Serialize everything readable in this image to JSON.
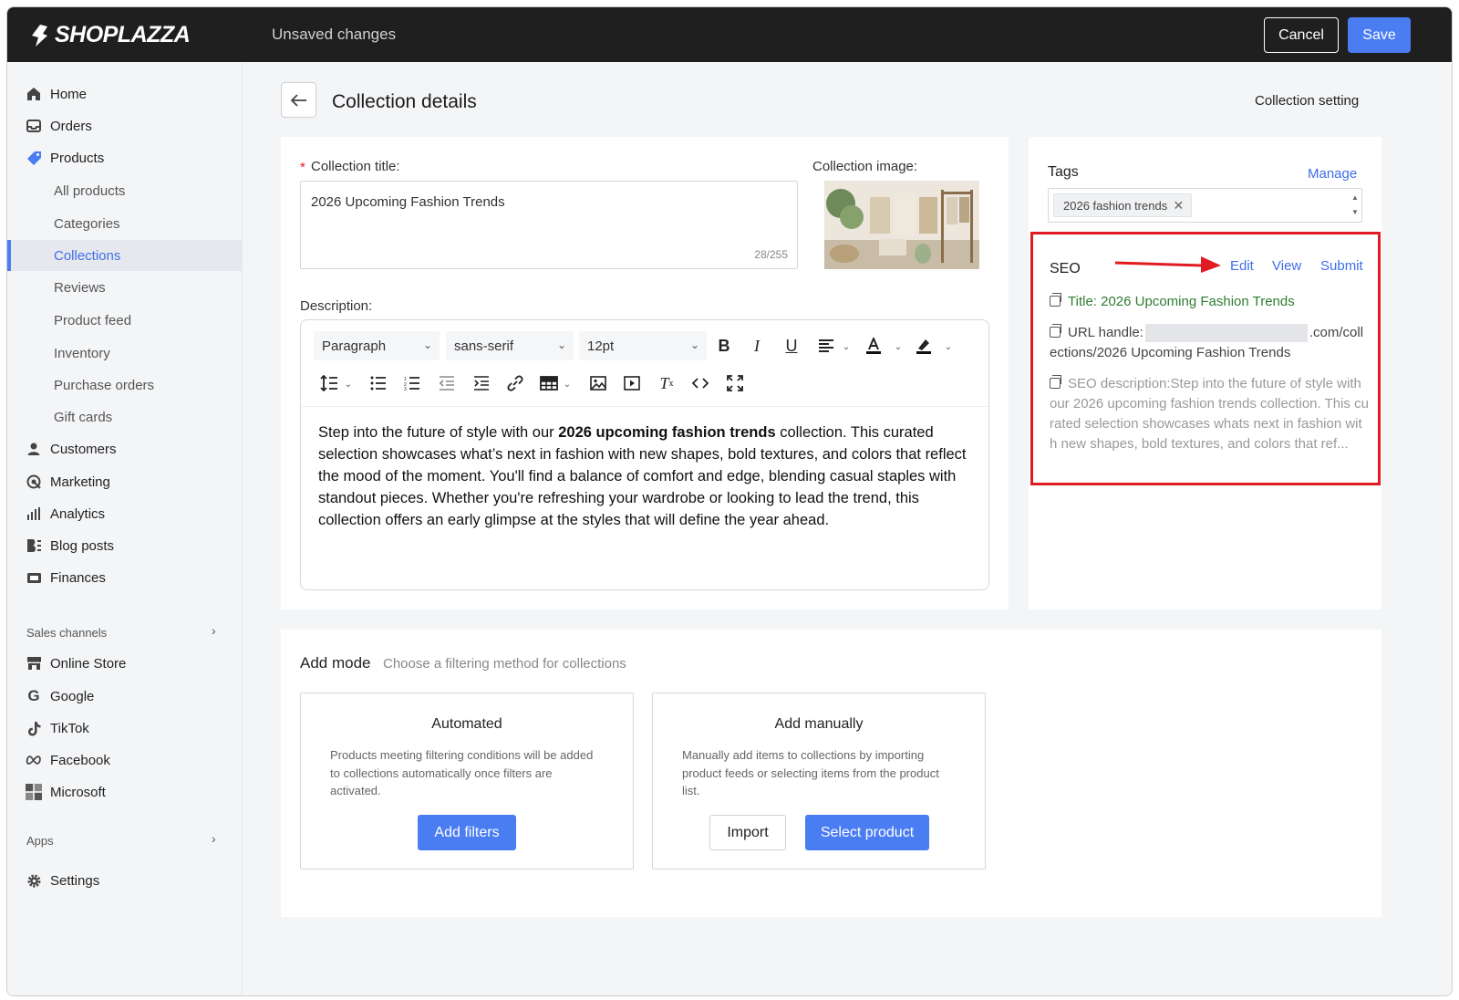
{
  "topbar": {
    "brand": "SHOPLAZZA",
    "status": "Unsaved changes",
    "cancel_label": "Cancel",
    "save_label": "Save"
  },
  "sidebar": {
    "items": [
      {
        "label": "Home",
        "icon": "home-icon"
      },
      {
        "label": "Orders",
        "icon": "inbox-icon"
      },
      {
        "label": "Products",
        "icon": "tag-icon"
      }
    ],
    "product_sub": [
      "All products",
      "Categories",
      "Collections",
      "Reviews",
      "Product feed",
      "Inventory",
      "Purchase orders",
      "Gift cards"
    ],
    "items2": [
      {
        "label": "Customers",
        "icon": "person-icon"
      },
      {
        "label": "Marketing",
        "icon": "target-icon"
      },
      {
        "label": "Analytics",
        "icon": "bar-chart-icon"
      },
      {
        "label": "Blog posts",
        "icon": "blog-icon"
      },
      {
        "label": "Finances",
        "icon": "wallet-icon"
      }
    ],
    "sales_channels_label": "Sales channels",
    "channels": [
      {
        "label": "Online Store",
        "icon": "store-icon"
      },
      {
        "label": "Google",
        "icon": "google-icon"
      },
      {
        "label": "TikTok",
        "icon": "tiktok-icon"
      },
      {
        "label": "Facebook",
        "icon": "meta-icon"
      },
      {
        "label": "Microsoft",
        "icon": "microsoft-icon"
      }
    ],
    "apps_label": "Apps",
    "settings_label": "Settings"
  },
  "page": {
    "title": "Collection details",
    "setting_link": "Collection setting"
  },
  "collection": {
    "title_label": "Collection title:",
    "required_mark": "*",
    "title_value": "2026 Upcoming Fashion Trends",
    "title_count": "28/255",
    "image_label": "Collection image:"
  },
  "description": {
    "label": "Description:",
    "paragraph_select": "Paragraph",
    "font_select": "sans-serif",
    "size_select": "12pt",
    "body_before": "Step into the future of style with our ",
    "body_bold": "2026 upcoming fashion trends",
    "body_after": " collection. This curated selection showcases what’s next in fashion with new shapes, bold textures, and colors that reflect the mood of the moment. You'll find a balance of comfort and edge, blending casual staples with standout pieces. Whether you're refreshing your wardrobe or looking to lead the trend, this collection offers an early glimpse at the styles that will define the year ahead."
  },
  "tags": {
    "label": "Tags",
    "manage": "Manage",
    "chip": "2026 fashion trends"
  },
  "seo": {
    "label": "SEO",
    "edit": "Edit",
    "view": "View",
    "submit": "Submit",
    "title_line": "Title: 2026 Upcoming Fashion Trends",
    "url_prefix": "URL handle:",
    "url_suffix": ".com/collections/2026 Upcoming Fashion Trends",
    "description_line": "SEO description:Step into the future of style with our 2026 upcoming fashion trends collection. This curated selection showcases whats next in fashion with new shapes, bold textures, and colors that ref..."
  },
  "add_mode": {
    "label": "Add mode",
    "hint": "Choose a filtering method for collections",
    "automated_title": "Automated",
    "automated_desc": "Products meeting filtering conditions will be added to collections automatically once filters are activated.",
    "add_filters": "Add filters",
    "manual_title": "Add manually",
    "manual_desc": "Manually add items to collections by importing product feeds or selecting items from the product list.",
    "import": "Import",
    "select_product": "Select product"
  },
  "colors": {
    "accent": "#4a7cf2",
    "topbar": "#1f1f1f",
    "highlight": "#e11b22",
    "seo_title": "#2e7d32"
  }
}
